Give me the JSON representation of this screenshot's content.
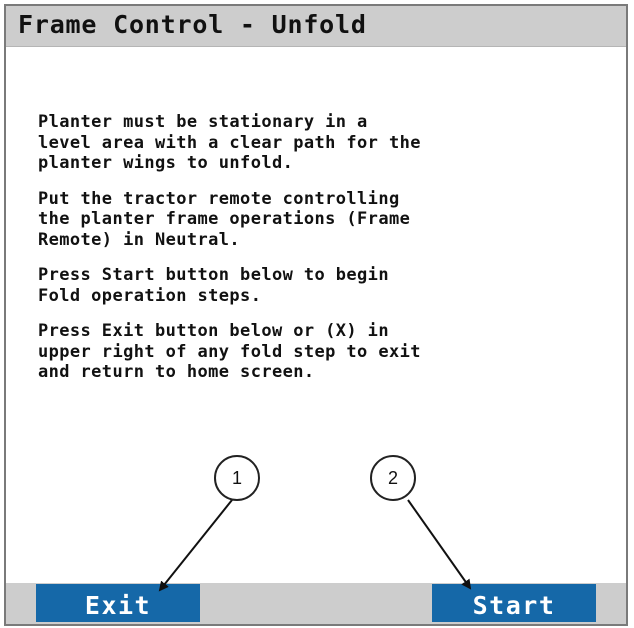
{
  "title_bar": {
    "title": "Frame Control - Unfold"
  },
  "instructions": [
    "Planter must be stationary in a\nlevel area with a clear path for the\nplanter wings to unfold.",
    "Put the tractor remote controlling\nthe planter frame operations (Frame\nRemote) in Neutral.",
    "Press Start button below to begin\nFold operation steps.",
    "Press Exit button below or (X) in\nupper right of any fold step to exit\nand return to home screen."
  ],
  "buttons": {
    "exit_label": "Exit",
    "start_label": "Start"
  },
  "callouts": {
    "exit_number": "1",
    "start_number": "2"
  },
  "colors": {
    "title_bar": "#cdcdcd",
    "button": "#1568a8",
    "button_text": "#ffffff",
    "text": "#111111"
  }
}
